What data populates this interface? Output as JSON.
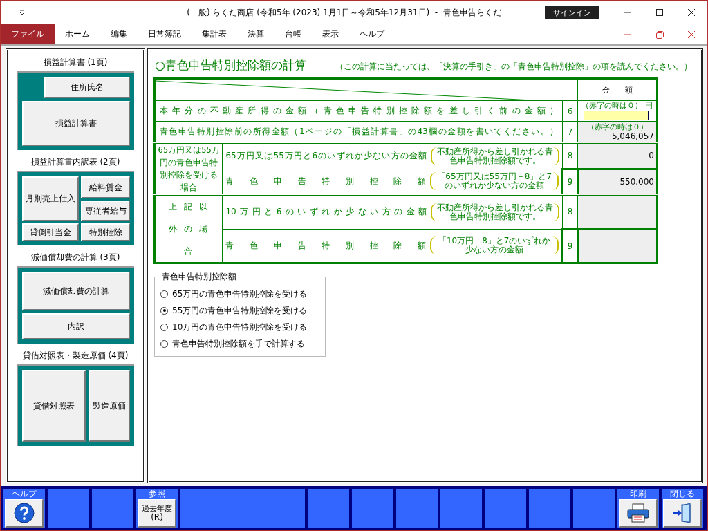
{
  "window": {
    "title": "(一般) らくだ商店 (令和5年 (2023) 1月1日～令和5年12月31日)  -  青色申告らくだ",
    "sign_in": "サインイン"
  },
  "menu": [
    {
      "label": "ファイル",
      "selected": true
    },
    {
      "label": "ホーム",
      "selected": false
    },
    {
      "label": "編集",
      "selected": false
    },
    {
      "label": "日常簿記",
      "selected": false
    },
    {
      "label": "集計表",
      "selected": false
    },
    {
      "label": "決算",
      "selected": false
    },
    {
      "label": "台帳",
      "selected": false
    },
    {
      "label": "表示",
      "selected": false
    },
    {
      "label": "ヘルプ",
      "selected": false
    }
  ],
  "sidebar": {
    "groups": [
      {
        "heading": "損益計算書 (1頁)",
        "kind": "offset",
        "buttons": [
          "住所氏名",
          "損益計算書"
        ]
      },
      {
        "heading": "損益計算書内訳表 (2頁)",
        "kind": "grid",
        "buttons": [
          "月別売上仕入",
          "貸倒引当金",
          "給料賃金",
          "専従者給与",
          "特別控除"
        ]
      },
      {
        "heading": "減価償却費の計算 (3頁)",
        "kind": "stack",
        "buttons": [
          "減価償却費の計算",
          "内訳"
        ]
      },
      {
        "heading": "貸借対照表・製造原価 (4頁)",
        "kind": "columns",
        "buttons": [
          "貸借対照表",
          "製造原価"
        ]
      }
    ]
  },
  "form": {
    "title": "○青色申告特別控除額の計算",
    "note": "（この計算に当たっては、「決算の手引き」の「青色申告特別控除」の項を読んでください。）",
    "amount_header": "金　　額",
    "rows": [
      {
        "label": "本年分の不動産所得の金額（青色申告特別控除額を差し引く前の金額）",
        "number": "6",
        "hint": "（赤字の時は０）",
        "unit": "円",
        "kind": "input"
      },
      {
        "label": "青色申告特別控除前の所得金額（1ページの「損益計算書」の43欄の金額を書いてください。）",
        "number": "7",
        "hint": "（赤字の時は０）",
        "value": "5,046,057",
        "kind": "value"
      }
    ],
    "sections": [
      {
        "heading": "65万円又は55万円の青色申告特別控除を受ける場合",
        "kind": "plain",
        "rows": [
          {
            "label": "65万円又は55万円と6のいずれか少ない方の金額",
            "note": "不動産所得から差し引かれる青色申告特別控除額です。",
            "number": "8",
            "value": "0",
            "kind": "value"
          },
          {
            "label": "青色申告特別控除額",
            "note": "「65万円又は55万円－8」と7のいずれか少ない方の金額",
            "number": "9",
            "value": "550,000",
            "kind": "total"
          }
        ]
      },
      {
        "heading": "上記以外の場合",
        "kind": "spaced",
        "rows": [
          {
            "label": "10万円と6のいずれか少ない方の金額",
            "note": "不動産所得から差し引かれる青色申告特別控除額です。",
            "number": "8",
            "kind": "value"
          },
          {
            "label": "青色申告特別控除額",
            "note": "「10万円－8」と7のいずれか少ない方の金額",
            "number": "9",
            "kind": "total"
          }
        ]
      }
    ],
    "options": {
      "legend": "青色申告特別控除額",
      "items": [
        {
          "label": "65万円の青色申告特別控除を受ける",
          "selected": false
        },
        {
          "label": "55万円の青色申告特別控除を受ける",
          "selected": true
        },
        {
          "label": "10万円の青色申告特別控除を受ける",
          "selected": false
        },
        {
          "label": "青色申告特別控除額を手で計算する",
          "selected": false
        }
      ]
    }
  },
  "function_keys": [
    {
      "label": "ヘルプ",
      "kind": "help"
    },
    {
      "kind": "empty"
    },
    {
      "kind": "empty"
    },
    {
      "label": "参照",
      "kind": "text",
      "button": "過去年度",
      "access_key": "(R)"
    },
    {
      "kind": "wide"
    },
    {
      "kind": "empty"
    },
    {
      "kind": "empty"
    },
    {
      "kind": "empty"
    },
    {
      "kind": "empty"
    },
    {
      "kind": "empty"
    },
    {
      "kind": "empty"
    },
    {
      "kind": "empty"
    },
    {
      "label": "印刷",
      "kind": "print"
    },
    {
      "label": "閉じる",
      "kind": "close"
    }
  ]
}
